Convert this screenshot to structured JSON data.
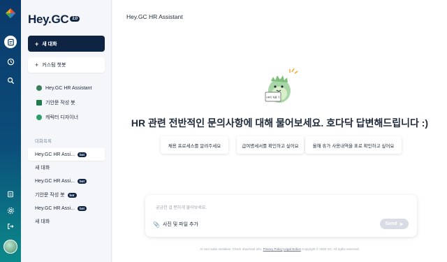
{
  "app": {
    "brand": "Hey.GC",
    "version": "2.0"
  },
  "rail": {
    "items": [
      "logo-icon",
      "chat-icon",
      "history-icon",
      "search-icon",
      "guide-icon",
      "settings-icon",
      "logout-icon",
      "avatar"
    ]
  },
  "sidebar": {
    "new_chat": "새 대화",
    "custom_bot": "커스텀 챗봇",
    "bots": [
      {
        "label": "Hey.GC HR Assistant",
        "color": "#3a7d5a"
      },
      {
        "label": "기안문 작성 봇",
        "color": "#1d7a4a"
      },
      {
        "label": "캐릭터 디자이너",
        "color": "#2a9d6a"
      }
    ],
    "section_label": "대화목록",
    "chats": [
      {
        "label": "Hey.GC HR Assi...",
        "badge": "bot"
      },
      {
        "label": "새 대화",
        "badge": ""
      },
      {
        "label": "Hey.GC HR Assi...",
        "badge": "bot"
      },
      {
        "label": "기안문 작성 봇",
        "badge": "bot"
      },
      {
        "label": "Hey.GC HR Assi...",
        "badge": "bot"
      },
      {
        "label": "새 대화",
        "badge": ""
      }
    ]
  },
  "main": {
    "title": "Hey.GC HR Assistant",
    "mascot_sign": "HR이 처음 기",
    "headline": "HR 관련 전반적인 문의사항에 대해 물어보세요. 호다닥 답변해드립니다 :)",
    "suggestions": [
      "채용 프로세스를 알려주세요",
      "급여명세서를 확인하고 싶어요",
      "올해 휴가 사용내역을 표로 확인하고 싶어요"
    ],
    "composer": {
      "placeholder": "궁금한 걸 편하게 물어보세요.",
      "attach": "사진 및 파일 추가",
      "send": "Send"
    },
    "footer": {
      "text": "AI can make mistakes. Check important info.",
      "privacy": "Privacy Policy",
      "legal": "Legal Notice",
      "copyright": "Copyright © 2025 GC. All rights reserved."
    }
  },
  "colors": {
    "primary": "#0f2442",
    "rail_top": "#0a3a6b",
    "rail_bottom": "#0b8a8a"
  }
}
